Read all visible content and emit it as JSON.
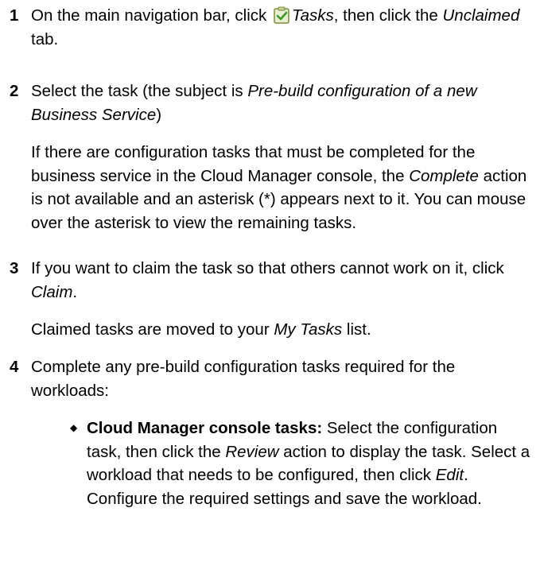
{
  "steps": [
    {
      "number": "1",
      "p1_a": "On the main navigation bar, click ",
      "icon": "tasks-clipboard-icon",
      "p1_b": "Tasks",
      "p1_c": ", then click the ",
      "p1_d": "Unclaimed",
      "p1_e": " tab."
    },
    {
      "number": "2",
      "p1_a": "Select the task (the subject is ",
      "p1_b": "Pre-build configuration of a new Business Service",
      "p1_c": ")",
      "p2_a": "If there are configuration tasks that must be completed for the business service in the Cloud Manager console, the ",
      "p2_b": "Complete",
      "p2_c": " action is not available and an asterisk (*) appears next to it. You can mouse over the asterisk to view the remaining tasks."
    },
    {
      "number": "3",
      "p1_a": "If you want to claim the task so that others cannot work on it, click ",
      "p1_b": "Claim",
      "p1_c": ".",
      "p2_a": "Claimed tasks are moved to your ",
      "p2_b": "My Tasks",
      "p2_c": " list."
    },
    {
      "number": "4",
      "p1_a": "Complete any pre-build configuration tasks required for the workloads:",
      "bullet": "◆",
      "b_title": "Cloud Manager console tasks:",
      "b_a": " Select the configuration task, then click the ",
      "b_b": "Review",
      "b_c": " action to display the task. Select a workload that needs to be configured, then click ",
      "b_d": "Edit",
      "b_e": ". Configure the required settings and save the workload."
    }
  ],
  "colors": {
    "icon_frame": "#7a8a3a",
    "icon_check": "#3a9a2a"
  }
}
